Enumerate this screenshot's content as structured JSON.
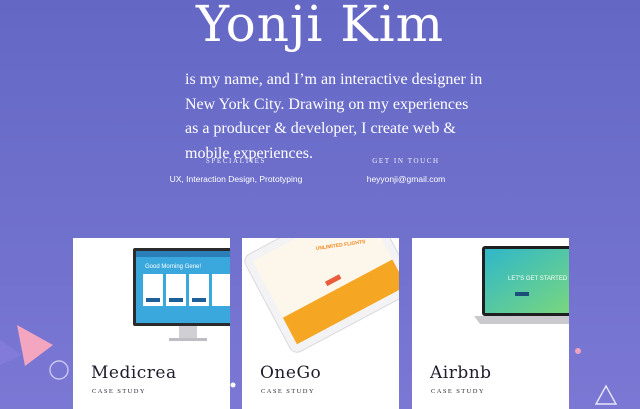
{
  "hero": {
    "name": "Yonji Kim",
    "intro": "is my name, and I’m an interactive designer in New York City. Drawing on my experiences as a producer & developer, I create web & mobile experiences."
  },
  "info": {
    "specialties_label": "SPECIALTIES",
    "specialties_value": "UX, Interaction Design, Prototyping",
    "contact_label": "GET IN TOUCH",
    "contact_value": "heyyonji@gmail.com"
  },
  "projects": [
    {
      "title": "Medicrea",
      "subtitle": "CASE STUDY",
      "thumb_text": "Good Morning Gene!",
      "icon": "desktop-monitor-icon"
    },
    {
      "title": "OneGo",
      "subtitle": "CASE STUDY",
      "thumb_text": "UNLIMITED FLIGHTS FOR UNLIMITED OPPORTUNITIES",
      "icon": "tablet-icon"
    },
    {
      "title": "Airbnb",
      "subtitle": "CASE STUDY",
      "thumb_text": "LET'S GET STARTED",
      "icon": "laptop-icon"
    }
  ],
  "colors": {
    "background_top": "#6468c4",
    "background_bottom": "#7b78d4",
    "medicrea_blue": "#3aa8dc",
    "onego_orange": "#f5a623",
    "airbnb_teal": "#37c3c9"
  }
}
